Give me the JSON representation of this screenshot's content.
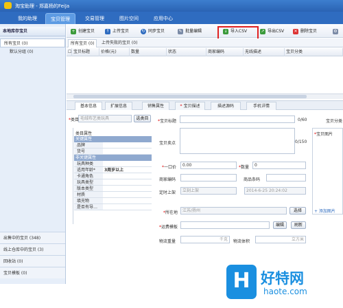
{
  "titlebar": {
    "title": "淘宝助理 - 郑嘉杨的FeiJa"
  },
  "nav": {
    "tabs": [
      "我的助理",
      "宝贝管理",
      "交易管理",
      "图片空间",
      "应用中心"
    ],
    "active": 1
  },
  "sidebar": {
    "header": "本地库存宝贝",
    "items": [
      "所有宝贝 (0)",
      "默认分组 (0)"
    ],
    "bottom_items": [
      "出售中的宝贝 (348)",
      "线上仓库中的宝贝 (3)",
      "回收站 (0)",
      "宝贝模板 (0)"
    ]
  },
  "toolbar": {
    "buttons": [
      "创建宝贝",
      "上传宝贝",
      "同步宝贝",
      "批量编辑",
      "导入CSV",
      "导出CSV",
      "删除宝贝"
    ]
  },
  "subtabs": [
    "所有宝贝 (0)",
    "上传失败的宝贝 (0)"
  ],
  "grid": {
    "columns": [
      "宝贝标题",
      "价格(元)",
      "数量",
      "状态",
      "商家编码",
      "无线描述",
      "宝贝分类"
    ]
  },
  "detail_tabs": [
    "基本信息",
    "扩展信息",
    "销售属性",
    "宝贝描述",
    "描述源码",
    "手机详情"
  ],
  "form": {
    "category_label": "类目",
    "category_value": "毛绒布艺类玩具",
    "select_category_btn": "选类目",
    "title_label": "宝贝标题",
    "title_counter": "0/60",
    "title_counter2": "0/150",
    "selling_point_label": "宝贝卖点",
    "category2_label": "宝贝分类",
    "pics_label": "宝贝图片",
    "price_label": "一口价",
    "price_value": "0.00",
    "qty_label": "数量",
    "qty_value": "0",
    "merchant_code_label": "商家编码",
    "barcode_label": "商品条码",
    "schedule_label": "定时上架",
    "schedule_value": "立刻上架",
    "datetime_value": "2014-6-25  20:24:02",
    "location_label": "所在地",
    "location_value": "江苏/扬州",
    "location_btn": "选择",
    "shipping_label": "运费模板",
    "edit_btn": "编辑",
    "refresh_btn": "刷新",
    "weight_label": "物流重量",
    "weight_unit": "千克",
    "volume_label": "物流体积",
    "volume_unit": "立方米",
    "add_pic": "+ 添加图片"
  },
  "props": {
    "header": "类目属性",
    "groups": [
      {
        "name": "关键属性",
        "rows": [
          {
            "k": "品牌",
            "v": ""
          },
          {
            "k": "货号",
            "v": ""
          }
        ]
      },
      {
        "name": "非关键属性",
        "rows": [
          {
            "k": "玩具种类",
            "v": ""
          },
          {
            "k": "适用年龄*",
            "v": "3周岁以上"
          },
          {
            "k": "卡通角色",
            "v": ""
          },
          {
            "k": "玩具类型",
            "v": ""
          },
          {
            "k": "版本类型",
            "v": ""
          },
          {
            "k": "材质",
            "v": ""
          },
          {
            "k": "填充物",
            "v": ""
          },
          {
            "k": "是否有导…",
            "v": ""
          }
        ]
      }
    ]
  },
  "watermark": {
    "brand_letter": "H",
    "brand_cn": "好特网",
    "url": "haote.com"
  },
  "colors": {
    "accent": "#2f6cc0",
    "highlight": "#e02020",
    "watermark": "#1a8fe0"
  }
}
